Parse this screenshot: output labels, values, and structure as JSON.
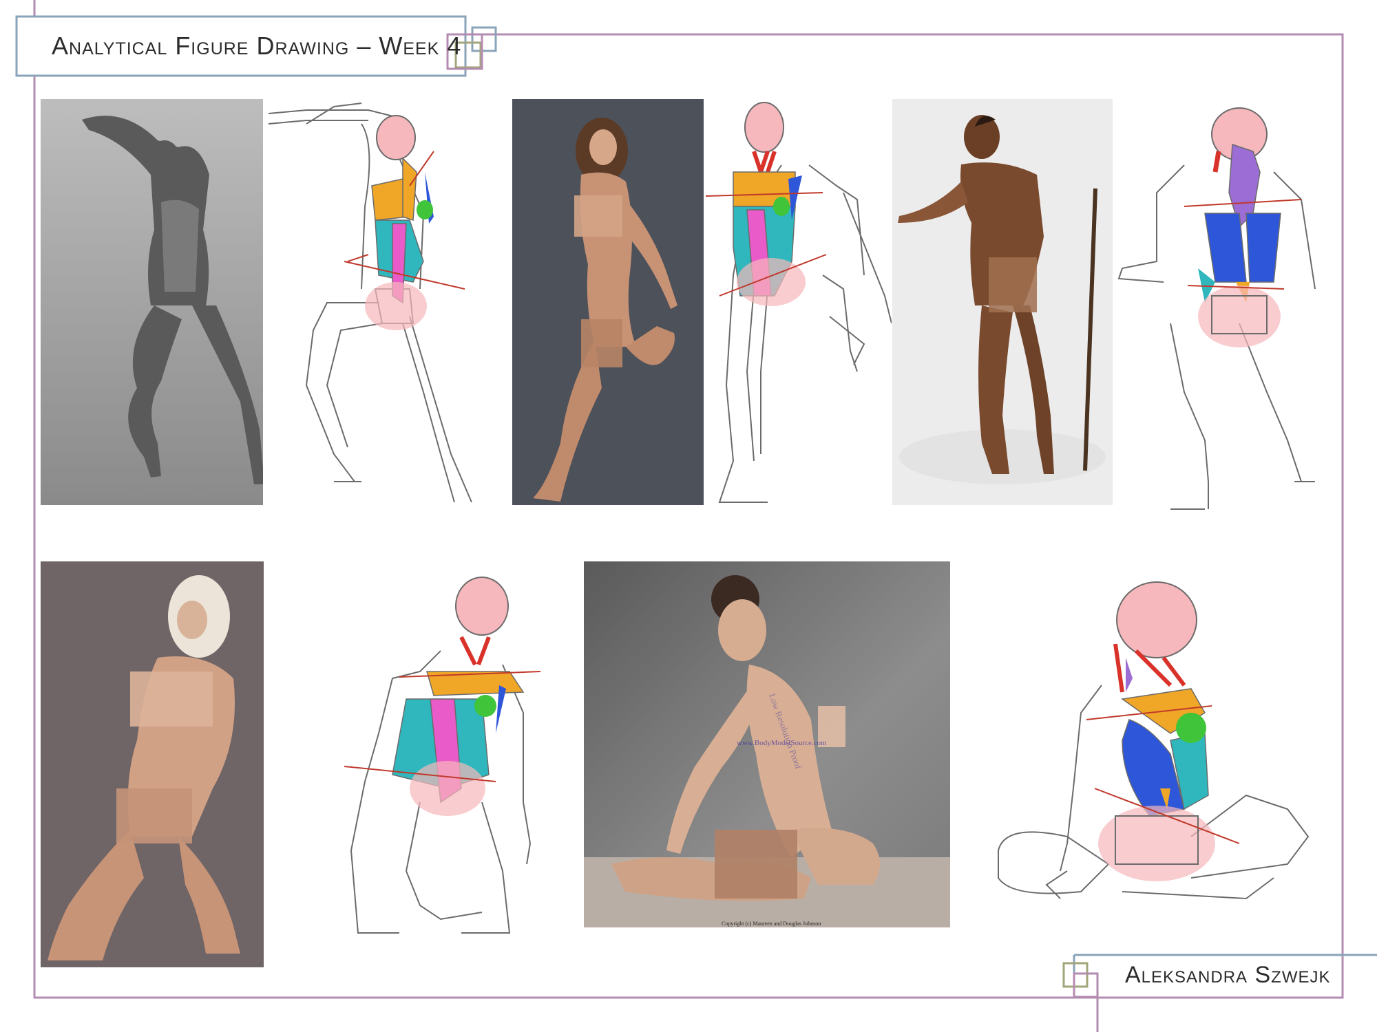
{
  "header": {
    "title": "Analytical Figure Drawing – Week 4"
  },
  "footer": {
    "author": "Aleksandra Szwejk"
  },
  "colors": {
    "frame_purple": "#b48bb0",
    "frame_blue": "#8aa3b8",
    "frame_olive": "#a2a57a",
    "head_pink": "#f6b8bc",
    "pec_orange": "#f0a626",
    "abs_magenta": "#e95bc8",
    "oblique_teal": "#2fb7bd",
    "serratus_green": "#3fc43a",
    "lat_blue": "#2e56d8",
    "neck_red": "#d8322a",
    "arrow_red": "#c0392b",
    "trap_violet": "#9c6dd4"
  },
  "watermarks": {
    "photo4": "Low Resolution Proof",
    "photo4_site": "www.BodyModelSource.com",
    "photo4_copyright": "Copyright (c) Maureen and Douglas Johnson"
  }
}
